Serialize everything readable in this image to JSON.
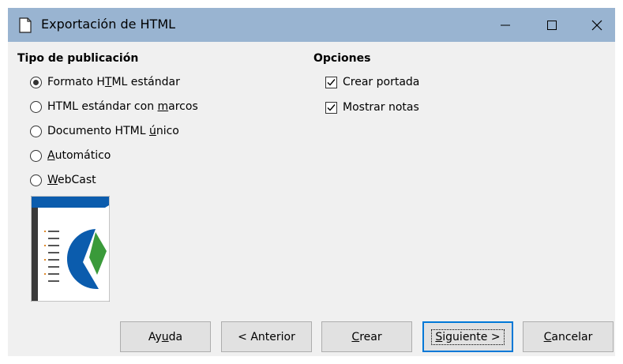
{
  "window": {
    "title": "Exportación de HTML",
    "controls": {
      "minimize": "minimize",
      "maximize": "maximize",
      "close": "close"
    }
  },
  "publication_type": {
    "heading": "Tipo de publicación",
    "options": [
      {
        "pre": "Formato H",
        "u": "T",
        "post": "ML estándar",
        "selected": true
      },
      {
        "pre": "HTML estándar con ",
        "u": "m",
        "post": "arcos",
        "selected": false
      },
      {
        "pre": "Documento HTML ",
        "u": "ú",
        "post": "nico",
        "selected": false
      },
      {
        "pre": "",
        "u": "A",
        "post": "utomático",
        "selected": false
      },
      {
        "pre": "",
        "u": "W",
        "post": "ebCast",
        "selected": false
      }
    ]
  },
  "options": {
    "heading": "Opciones",
    "items": [
      {
        "label": "Crear portada",
        "checked": true
      },
      {
        "label": "Mostrar notas",
        "checked": true
      }
    ]
  },
  "buttons": {
    "help": {
      "pre": "Ay",
      "u": "u",
      "post": "da"
    },
    "back": {
      "pre": "< Anterior",
      "u": "",
      "post": ""
    },
    "create": {
      "pre": "",
      "u": "C",
      "post": "rear"
    },
    "next": {
      "pre": "",
      "u": "S",
      "post": "iguiente >"
    },
    "cancel": {
      "pre": "",
      "u": "C",
      "post": "ancelar"
    }
  },
  "colors": {
    "titlebar": "#99b4d1",
    "dialog_bg": "#f0f0f0",
    "default_button_border": "#0078d7",
    "preview_blue": "#0b5cad",
    "preview_green": "#3a9a3a"
  }
}
